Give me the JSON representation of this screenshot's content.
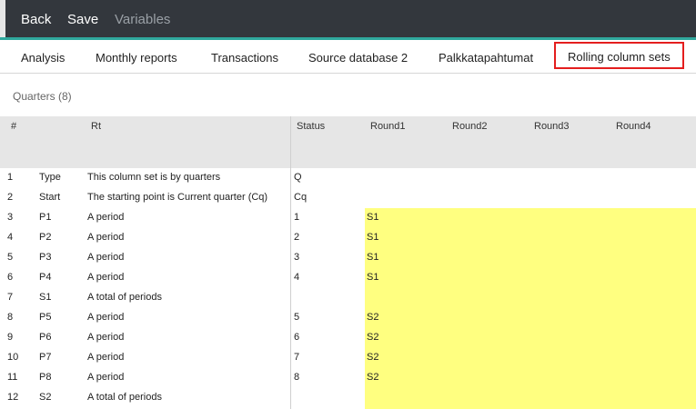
{
  "toolbar": {
    "back": "Back",
    "save": "Save",
    "variables": "Variables"
  },
  "tabs": [
    "Analysis",
    "Monthly reports",
    "Transactions",
    "Source database 2",
    "Palkkatapahtumat",
    "Rolling column sets"
  ],
  "column_set_title": "Quarters (8)",
  "columns": {
    "num": "#",
    "rt": "Rt",
    "status": "Status",
    "r1": "Round1",
    "r2": "Round2",
    "r3": "Round3",
    "r4": "Round4"
  },
  "rows": [
    {
      "num": "1",
      "code": "Type",
      "desc": "This column set is by quarters",
      "status": "Q",
      "r1": ""
    },
    {
      "num": "2",
      "code": "Start",
      "desc": "The starting point is Current quarter (Cq)",
      "status": "Cq",
      "r1": ""
    },
    {
      "num": "3",
      "code": "P1",
      "desc": "A period",
      "status": "1",
      "r1": "S1"
    },
    {
      "num": "4",
      "code": "P2",
      "desc": "A period",
      "status": "2",
      "r1": "S1"
    },
    {
      "num": "5",
      "code": "P3",
      "desc": "A period",
      "status": "3",
      "r1": "S1"
    },
    {
      "num": "6",
      "code": "P4",
      "desc": "A period",
      "status": "4",
      "r1": "S1"
    },
    {
      "num": "7",
      "code": "S1",
      "desc": "A total of periods",
      "status": "",
      "r1": ""
    },
    {
      "num": "8",
      "code": "P5",
      "desc": "A period",
      "status": "5",
      "r1": "S2"
    },
    {
      "num": "9",
      "code": "P6",
      "desc": "A period",
      "status": "6",
      "r1": "S2"
    },
    {
      "num": "10",
      "code": "P7",
      "desc": "A period",
      "status": "7",
      "r1": "S2"
    },
    {
      "num": "11",
      "code": "P8",
      "desc": "A period",
      "status": "8",
      "r1": "S2"
    },
    {
      "num": "12",
      "code": "S2",
      "desc": "A total of periods",
      "status": "",
      "r1": ""
    }
  ]
}
